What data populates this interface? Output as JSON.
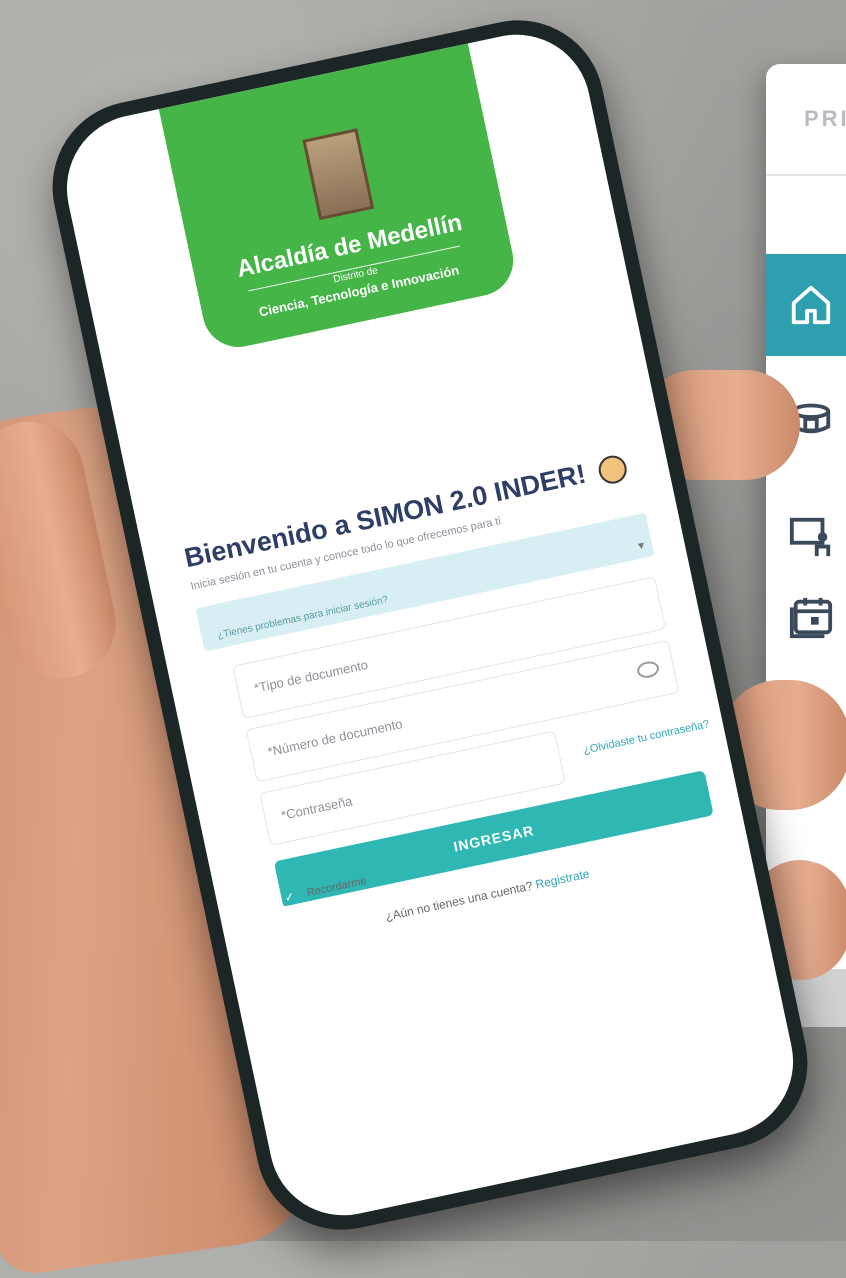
{
  "side_panel": {
    "header_text": "PRI",
    "items": [
      {
        "icon": "home-icon",
        "active": true
      },
      {
        "icon": "stadium-icon",
        "active": false
      },
      {
        "icon": "presentation-icon",
        "active": false
      },
      {
        "icon": "calendar-icon",
        "active": false
      }
    ],
    "accent_color": "#2e9fae"
  },
  "logo": {
    "title": "Alcaldía de Medellín",
    "subtitle1": "Distrito de",
    "subtitle2": "Ciencia, Tecnología e Innovación",
    "bg_color": "#45b548"
  },
  "login": {
    "welcome": "Bienvenido a SIMON 2.0 INDER!",
    "welcome_sub": "Inicia sesión en tu cuenta y conoce todo lo que ofrecemos para ti",
    "select_hint": "¿Tienes problemas para iniciar sesión?",
    "doc_type_placeholder": "*Tipo de documento",
    "doc_number_placeholder": "*Número de documento",
    "password_placeholder": "*Contraseña",
    "forgot": "¿Olvidaste tu contraseña?",
    "remember": "Recordarme",
    "submit": "INGRESAR",
    "no_account": "¿Aún no tienes una cuenta?",
    "register": "Registrate",
    "button_color": "#2fb7b3"
  }
}
